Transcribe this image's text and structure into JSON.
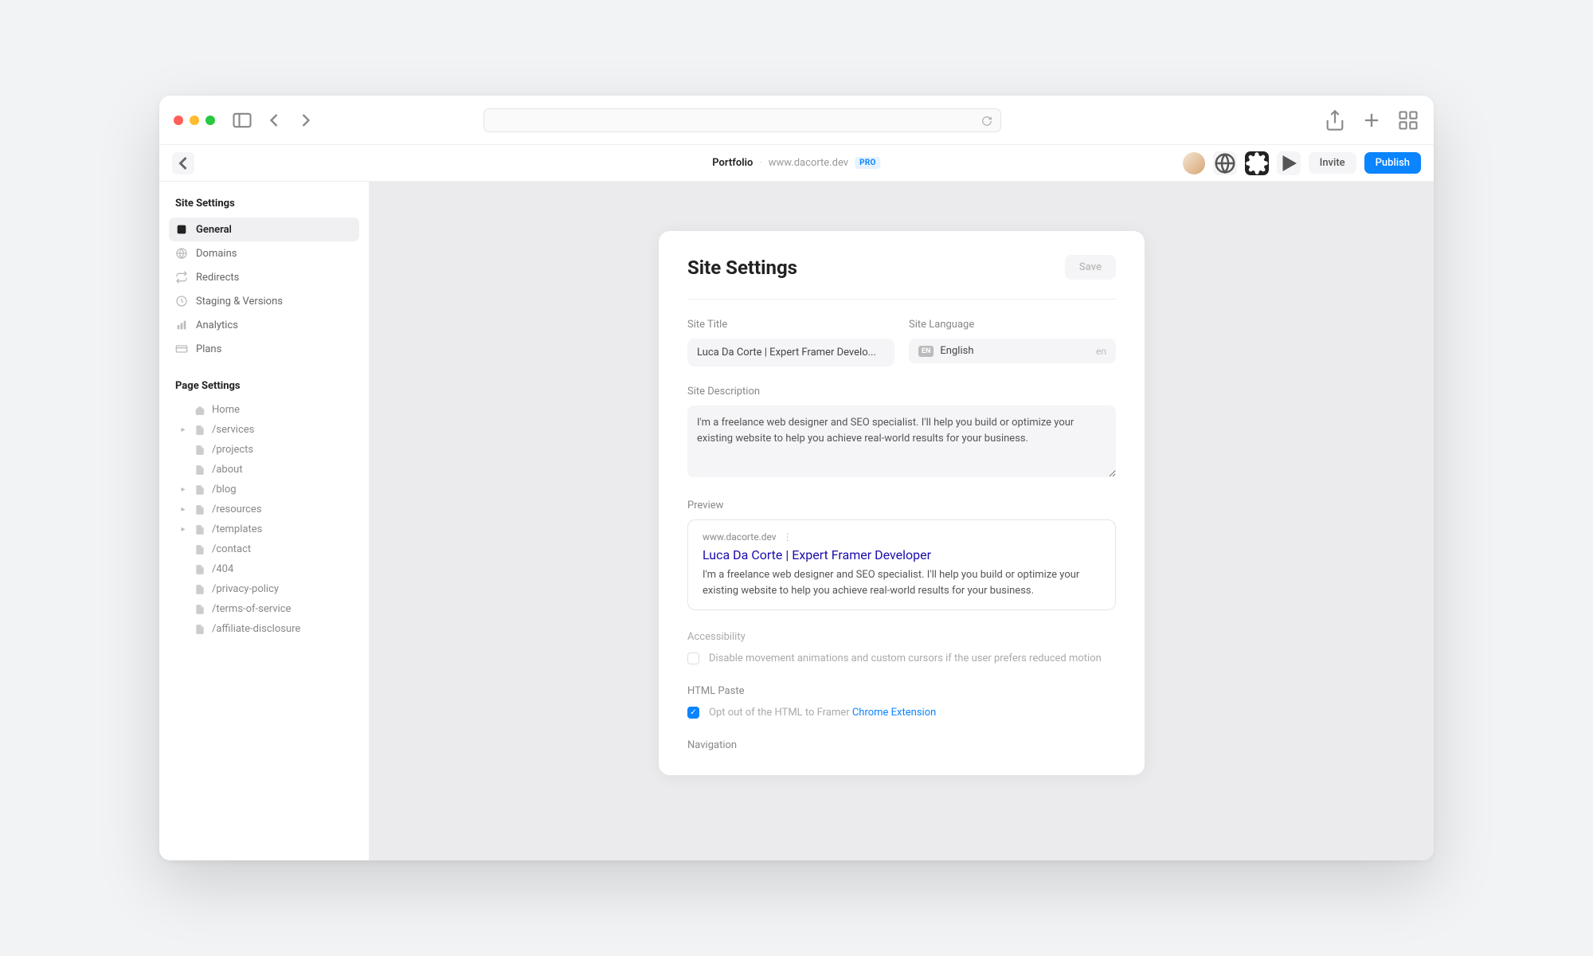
{
  "header": {
    "title": "Portfolio",
    "domain": "www.dacorte.dev",
    "badge": "PRO",
    "invite": "Invite",
    "publish": "Publish"
  },
  "sidebar": {
    "site_heading": "Site Settings",
    "page_heading": "Page Settings",
    "site_items": [
      {
        "label": "General",
        "icon": "square-icon",
        "active": true
      },
      {
        "label": "Domains",
        "icon": "globe-icon",
        "active": false
      },
      {
        "label": "Redirects",
        "icon": "redirect-icon",
        "active": false
      },
      {
        "label": "Staging & Versions",
        "icon": "clock-icon",
        "active": false
      },
      {
        "label": "Analytics",
        "icon": "chart-icon",
        "active": false
      },
      {
        "label": "Plans",
        "icon": "card-icon",
        "active": false
      }
    ],
    "page_items": [
      {
        "label": "Home",
        "icon": "home",
        "expandable": false
      },
      {
        "label": "/services",
        "icon": "page",
        "expandable": true
      },
      {
        "label": "/projects",
        "icon": "page",
        "expandable": false
      },
      {
        "label": "/about",
        "icon": "page",
        "expandable": false
      },
      {
        "label": "/blog",
        "icon": "page",
        "expandable": true
      },
      {
        "label": "/resources",
        "icon": "page",
        "expandable": true
      },
      {
        "label": "/templates",
        "icon": "page",
        "expandable": true
      },
      {
        "label": "/contact",
        "icon": "page",
        "expandable": false
      },
      {
        "label": "/404",
        "icon": "page",
        "expandable": false
      },
      {
        "label": "/privacy-policy",
        "icon": "page",
        "expandable": false
      },
      {
        "label": "/terms-of-service",
        "icon": "page",
        "expandable": false
      },
      {
        "label": "/affiliate-disclosure",
        "icon": "page",
        "expandable": false
      }
    ]
  },
  "form": {
    "title": "Site Settings",
    "save": "Save",
    "site_title_label": "Site Title",
    "site_title_value": "Luca Da Corte | Expert Framer Develo...",
    "site_lang_label": "Site Language",
    "site_lang_badge": "EN",
    "site_lang_value": "English",
    "site_lang_code": "en",
    "site_desc_label": "Site Description",
    "site_desc_value": "I'm a freelance web designer and SEO specialist. I'll help you build or optimize your existing website to help you achieve real-world results for your business.",
    "preview_label": "Preview",
    "preview_url": "www.dacorte.dev",
    "preview_title": "Luca Da Corte | Expert Framer Developer",
    "preview_desc": "I'm a freelance web designer and SEO specialist. I'll help you build or optimize your existing website to help you achieve real-world results for your business.",
    "accessibility_label": "Accessibility",
    "accessibility_text": "Disable movement animations and custom cursors if the user prefers reduced motion",
    "html_paste_label": "HTML Paste",
    "html_paste_text": "Opt out of the HTML to Framer ",
    "html_paste_link": "Chrome Extension",
    "navigation_label": "Navigation"
  }
}
